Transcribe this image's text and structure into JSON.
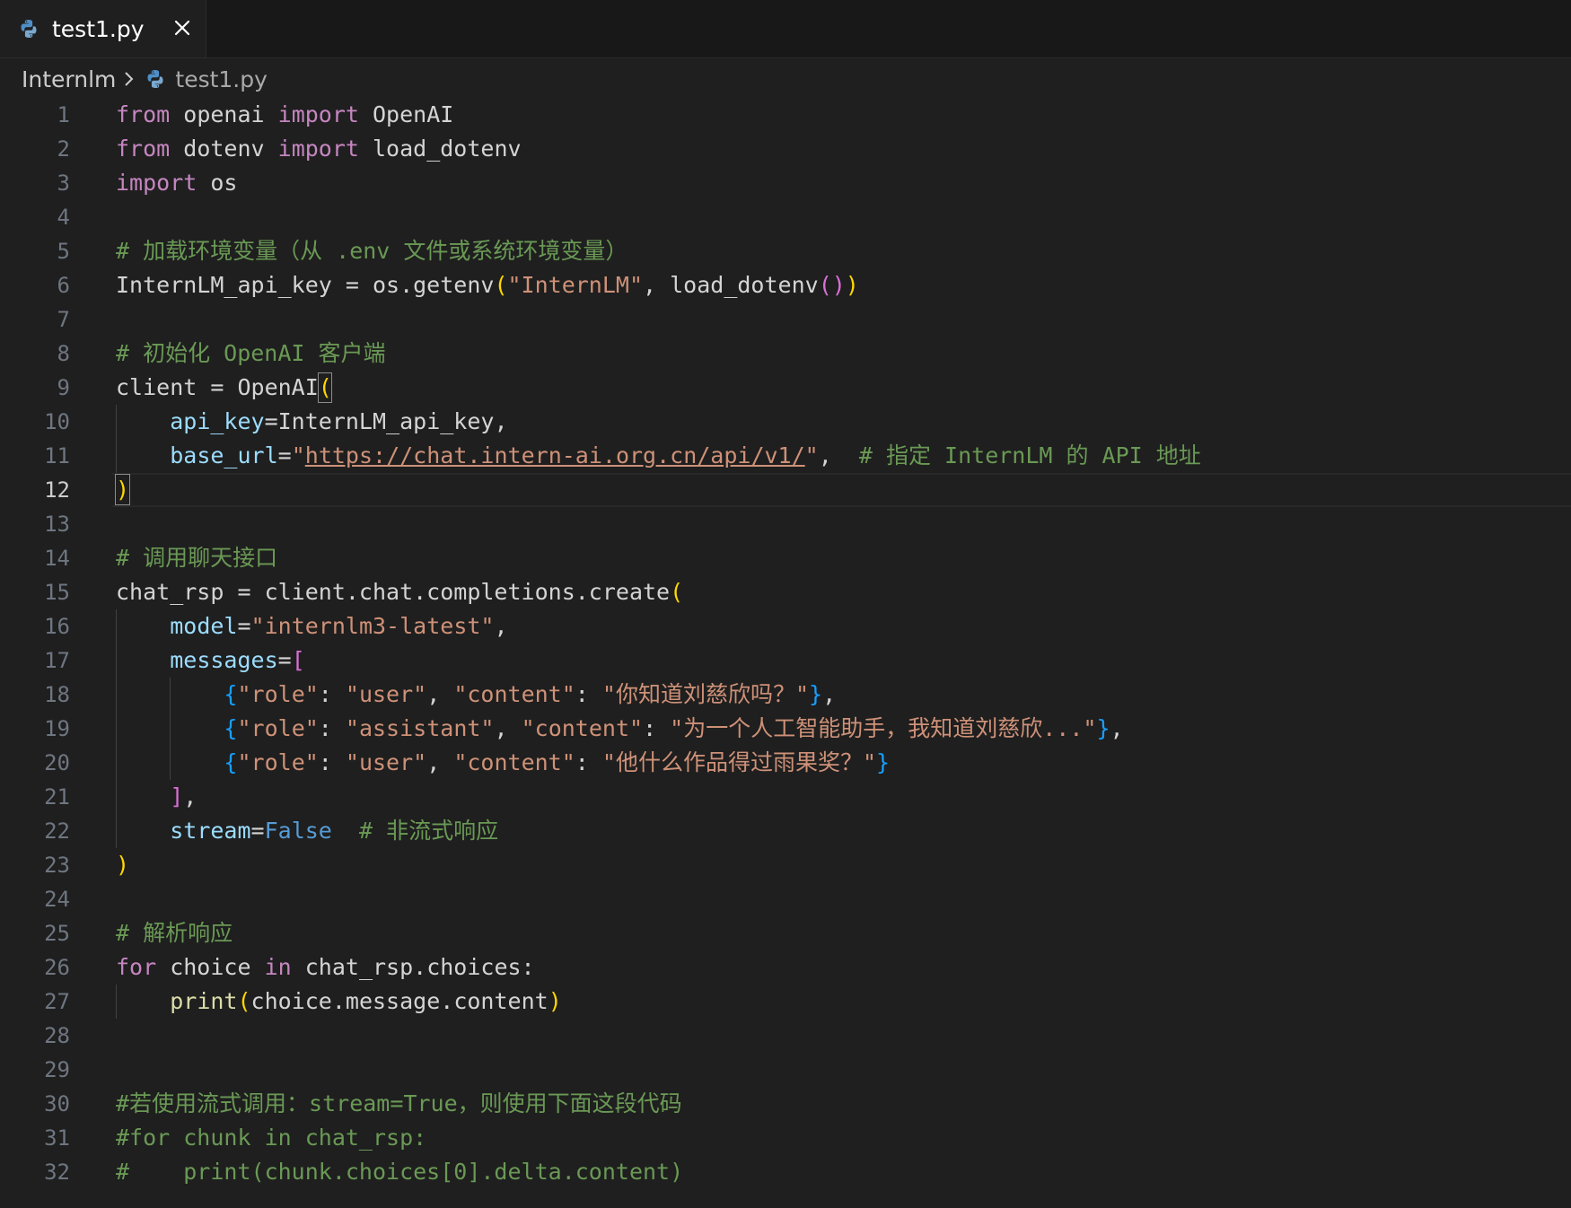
{
  "tab": {
    "label": "test1.py",
    "close_glyph": "✕",
    "icon": "python-file-icon"
  },
  "breadcrumb": {
    "folder": "Internlm",
    "separator_icon": "chevron-right-icon",
    "file": "test1.py",
    "file_icon": "python-file-icon"
  },
  "editor": {
    "active_line": "12",
    "lines": [
      {
        "num": "1",
        "tokens": [
          [
            "kw",
            "from"
          ],
          [
            "pl",
            " openai "
          ],
          [
            "kw",
            "import"
          ],
          [
            "pl",
            " OpenAI"
          ]
        ]
      },
      {
        "num": "2",
        "tokens": [
          [
            "kw",
            "from"
          ],
          [
            "pl",
            " dotenv "
          ],
          [
            "kw",
            "import"
          ],
          [
            "pl",
            " load_dotenv"
          ]
        ]
      },
      {
        "num": "3",
        "tokens": [
          [
            "kw",
            "import"
          ],
          [
            "pl",
            " os"
          ]
        ]
      },
      {
        "num": "4",
        "tokens": []
      },
      {
        "num": "5",
        "tokens": [
          [
            "cm",
            "# 加载环境变量（从 .env 文件或系统环境变量）"
          ]
        ]
      },
      {
        "num": "6",
        "tokens": [
          [
            "pl",
            "InternLM_api_key = os.getenv"
          ],
          [
            "b1",
            "("
          ],
          [
            "str",
            "\"InternLM\""
          ],
          [
            "pl",
            ", load_dotenv"
          ],
          [
            "b2",
            "()"
          ],
          [
            "b1",
            ")"
          ]
        ]
      },
      {
        "num": "7",
        "tokens": []
      },
      {
        "num": "8",
        "tokens": [
          [
            "cm",
            "# 初始化 OpenAI 客户端"
          ]
        ]
      },
      {
        "num": "9",
        "tokens": [
          [
            "pl",
            "client = OpenAI"
          ],
          [
            "b1",
            "("
          ]
        ]
      },
      {
        "num": "10",
        "tokens": [
          [
            "pl",
            "    "
          ],
          [
            "var",
            "api_key"
          ],
          [
            "pl",
            "=InternLM_api_key,"
          ]
        ]
      },
      {
        "num": "11",
        "tokens": [
          [
            "pl",
            "    "
          ],
          [
            "var",
            "base_url"
          ],
          [
            "pl",
            "="
          ],
          [
            "str",
            "\""
          ],
          [
            "str ul",
            "https://chat.intern-ai.org.cn/api/v1/"
          ],
          [
            "str",
            "\""
          ],
          [
            "pl",
            ",  "
          ],
          [
            "cm",
            "# 指定 InternLM 的 API 地址"
          ]
        ]
      },
      {
        "num": "12",
        "tokens": [
          [
            "b1",
            ")"
          ]
        ]
      },
      {
        "num": "13",
        "tokens": []
      },
      {
        "num": "14",
        "tokens": [
          [
            "cm",
            "# 调用聊天接口"
          ]
        ]
      },
      {
        "num": "15",
        "tokens": [
          [
            "pl",
            "chat_rsp = client.chat.completions.create"
          ],
          [
            "b1",
            "("
          ]
        ]
      },
      {
        "num": "16",
        "tokens": [
          [
            "pl",
            "    "
          ],
          [
            "var",
            "model"
          ],
          [
            "pl",
            "="
          ],
          [
            "str",
            "\"internlm3-latest\""
          ],
          [
            "pl",
            ","
          ]
        ]
      },
      {
        "num": "17",
        "tokens": [
          [
            "pl",
            "    "
          ],
          [
            "var",
            "messages"
          ],
          [
            "pl",
            "="
          ],
          [
            "b2",
            "["
          ]
        ]
      },
      {
        "num": "18",
        "tokens": [
          [
            "pl",
            "        "
          ],
          [
            "b3",
            "{"
          ],
          [
            "str",
            "\"role\""
          ],
          [
            "pl",
            ": "
          ],
          [
            "str",
            "\"user\""
          ],
          [
            "pl",
            ", "
          ],
          [
            "str",
            "\"content\""
          ],
          [
            "pl",
            ": "
          ],
          [
            "str",
            "\"你知道刘慈欣吗？\""
          ],
          [
            "b3",
            "}"
          ],
          [
            "pl",
            ","
          ]
        ]
      },
      {
        "num": "19",
        "tokens": [
          [
            "pl",
            "        "
          ],
          [
            "b3",
            "{"
          ],
          [
            "str",
            "\"role\""
          ],
          [
            "pl",
            ": "
          ],
          [
            "str",
            "\"assistant\""
          ],
          [
            "pl",
            ", "
          ],
          [
            "str",
            "\"content\""
          ],
          [
            "pl",
            ": "
          ],
          [
            "str",
            "\"为一个人工智能助手，我知道刘慈欣...\""
          ],
          [
            "b3",
            "}"
          ],
          [
            "pl",
            ","
          ]
        ]
      },
      {
        "num": "20",
        "tokens": [
          [
            "pl",
            "        "
          ],
          [
            "b3",
            "{"
          ],
          [
            "str",
            "\"role\""
          ],
          [
            "pl",
            ": "
          ],
          [
            "str",
            "\"user\""
          ],
          [
            "pl",
            ", "
          ],
          [
            "str",
            "\"content\""
          ],
          [
            "pl",
            ": "
          ],
          [
            "str",
            "\"他什么作品得过雨果奖？\""
          ],
          [
            "b3",
            "}"
          ]
        ]
      },
      {
        "num": "21",
        "tokens": [
          [
            "pl",
            "    "
          ],
          [
            "b2",
            "]"
          ],
          [
            "pl",
            ","
          ]
        ]
      },
      {
        "num": "22",
        "tokens": [
          [
            "pl",
            "    "
          ],
          [
            "var",
            "stream"
          ],
          [
            "pl",
            "="
          ],
          [
            "const",
            "False"
          ],
          [
            "pl",
            "  "
          ],
          [
            "cm",
            "# 非流式响应"
          ]
        ]
      },
      {
        "num": "23",
        "tokens": [
          [
            "b1",
            ")"
          ]
        ]
      },
      {
        "num": "24",
        "tokens": []
      },
      {
        "num": "25",
        "tokens": [
          [
            "cm",
            "# 解析响应"
          ]
        ]
      },
      {
        "num": "26",
        "tokens": [
          [
            "kw",
            "for"
          ],
          [
            "pl",
            " choice "
          ],
          [
            "kw",
            "in"
          ],
          [
            "pl",
            " chat_rsp.choices:"
          ]
        ]
      },
      {
        "num": "27",
        "tokens": [
          [
            "pl",
            "    "
          ],
          [
            "fn",
            "print"
          ],
          [
            "b1",
            "("
          ],
          [
            "pl",
            "choice.message.content"
          ],
          [
            "b1",
            ")"
          ]
        ]
      },
      {
        "num": "28",
        "tokens": []
      },
      {
        "num": "29",
        "tokens": []
      },
      {
        "num": "30",
        "tokens": [
          [
            "cm",
            "#若使用流式调用：stream=True，则使用下面这段代码"
          ]
        ]
      },
      {
        "num": "31",
        "tokens": [
          [
            "cm",
            "#for chunk in chat_rsp:"
          ]
        ]
      },
      {
        "num": "32",
        "tokens": [
          [
            "cm",
            "#    print(chunk.choices[0].delta.content)"
          ]
        ]
      }
    ]
  }
}
